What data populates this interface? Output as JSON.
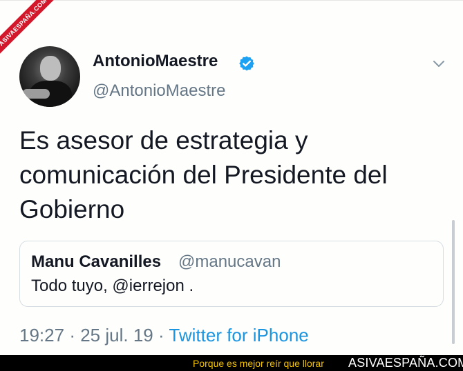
{
  "watermark": {
    "corner_text": "ASIVAESPAÑA.COM"
  },
  "tweet": {
    "display_name": "AntonioMaestre",
    "handle": "@AntonioMaestre",
    "verified": true,
    "text": "Es asesor de estrategia y comunicación del Presidente del Gobierno",
    "quoted": {
      "display_name": "Manu Cavanilles",
      "handle": "@manucavan",
      "text": "Todo tuyo, @ierrejon ."
    },
    "time": "19:27",
    "separator": "·",
    "date": "25 jul. 19",
    "source": "Twitter for iPhone"
  },
  "footer": {
    "slogan": "Porque es mejor reír que llorar",
    "brand": "ASIVAESPAÑA.COM"
  },
  "colors": {
    "verified_badge": "#1da1f2",
    "link": "#1b95e0",
    "secondary_text": "#657786",
    "footer_slogan": "#f2c200",
    "corner_ribbon": "#d4182b"
  },
  "icons": [
    "verified-badge-icon",
    "chevron-down-icon"
  ]
}
